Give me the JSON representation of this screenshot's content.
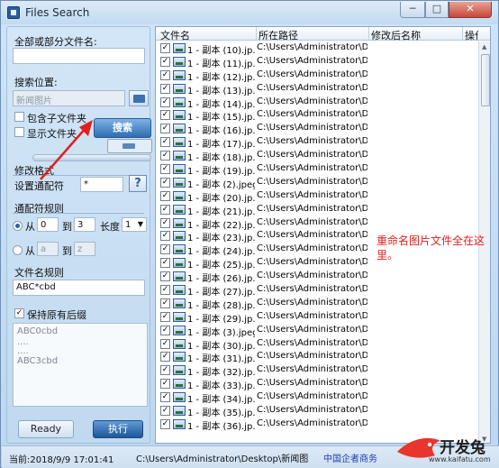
{
  "window": {
    "title": "Files Search",
    "min": "─",
    "max": "□",
    "close": "✕"
  },
  "left": {
    "name_label": "全部或部分文件名:",
    "name_value": "",
    "location_label": "搜索位置:",
    "location_value": "新闻图片",
    "include_sub": {
      "label": "包含子文件夹",
      "checked": false
    },
    "show_folder": {
      "label": "显示文件夹",
      "checked": false
    },
    "search_button": "搜索",
    "modify_format": "修改格式",
    "wildcard_label": "设置通配符",
    "wildcard_value": "*",
    "help": "?",
    "rule_title": "通配符规则",
    "from1": "从",
    "from1_value": "0",
    "to1": "到",
    "to1_value": "3",
    "length_label": "长度",
    "length_value": "1",
    "from2": "从",
    "from2_value": "a",
    "to2": "到",
    "to2_value": "z",
    "filename_rule_label": "文件名规则",
    "filename_rule_value": "ABC*cbd",
    "keep_ext": {
      "label": "保持原有后缀",
      "checked": true
    },
    "examples": [
      "ABC0cbd",
      "....",
      "....",
      "ABC3cbd"
    ],
    "ready": "Ready",
    "execute": "执行"
  },
  "grid": {
    "columns": [
      "文件名",
      "所在路径",
      "修改后名称",
      "操作"
    ],
    "path": "C:\\Users\\Administrator\\De...",
    "rows": [
      "1 - 副本 (10).jp...",
      "1 - 副本 (11).jp...",
      "1 - 副本 (12).jp...",
      "1 - 副本 (13).jp...",
      "1 - 副本 (14).jp...",
      "1 - 副本 (15).jp...",
      "1 - 副本 (16).jp...",
      "1 - 副本 (17).jp...",
      "1 - 副本 (18).jp...",
      "1 - 副本 (19).jp...",
      "1 - 副本 (2).jpeg",
      "1 - 副本 (20).jp...",
      "1 - 副本 (21).jp...",
      "1 - 副本 (22).jp...",
      "1 - 副本 (23).jp...",
      "1 - 副本 (24).jp...",
      "1 - 副本 (25).jp...",
      "1 - 副本 (26).jp...",
      "1 - 副本 (27).jp...",
      "1 - 副本 (28).jp...",
      "1 - 副本 (29).jp...",
      "1 - 副本 (3).jpeg",
      "1 - 副本 (30).jp...",
      "1 - 副本 (31).jp...",
      "1 - 副本 (32).jp...",
      "1 - 副本 (33).jp...",
      "1 - 副本 (34).jp...",
      "1 - 副本 (35).jp...",
      "1 - 副本 (36).jp..."
    ],
    "annotation": "重命名图片文件全在这里。"
  },
  "status": {
    "time": "当前:2018/9/9 17:01:41",
    "path": "C:\\Users\\Administrator\\Desktop\\新闻图",
    "watermark": "中国企者商务",
    "logo": "开发兔",
    "logo_sub": "www.kaifatu.com"
  },
  "colors": {
    "accent": "#2f6cb1",
    "annotation": "#e0201c",
    "arrow": "#e0201c"
  }
}
